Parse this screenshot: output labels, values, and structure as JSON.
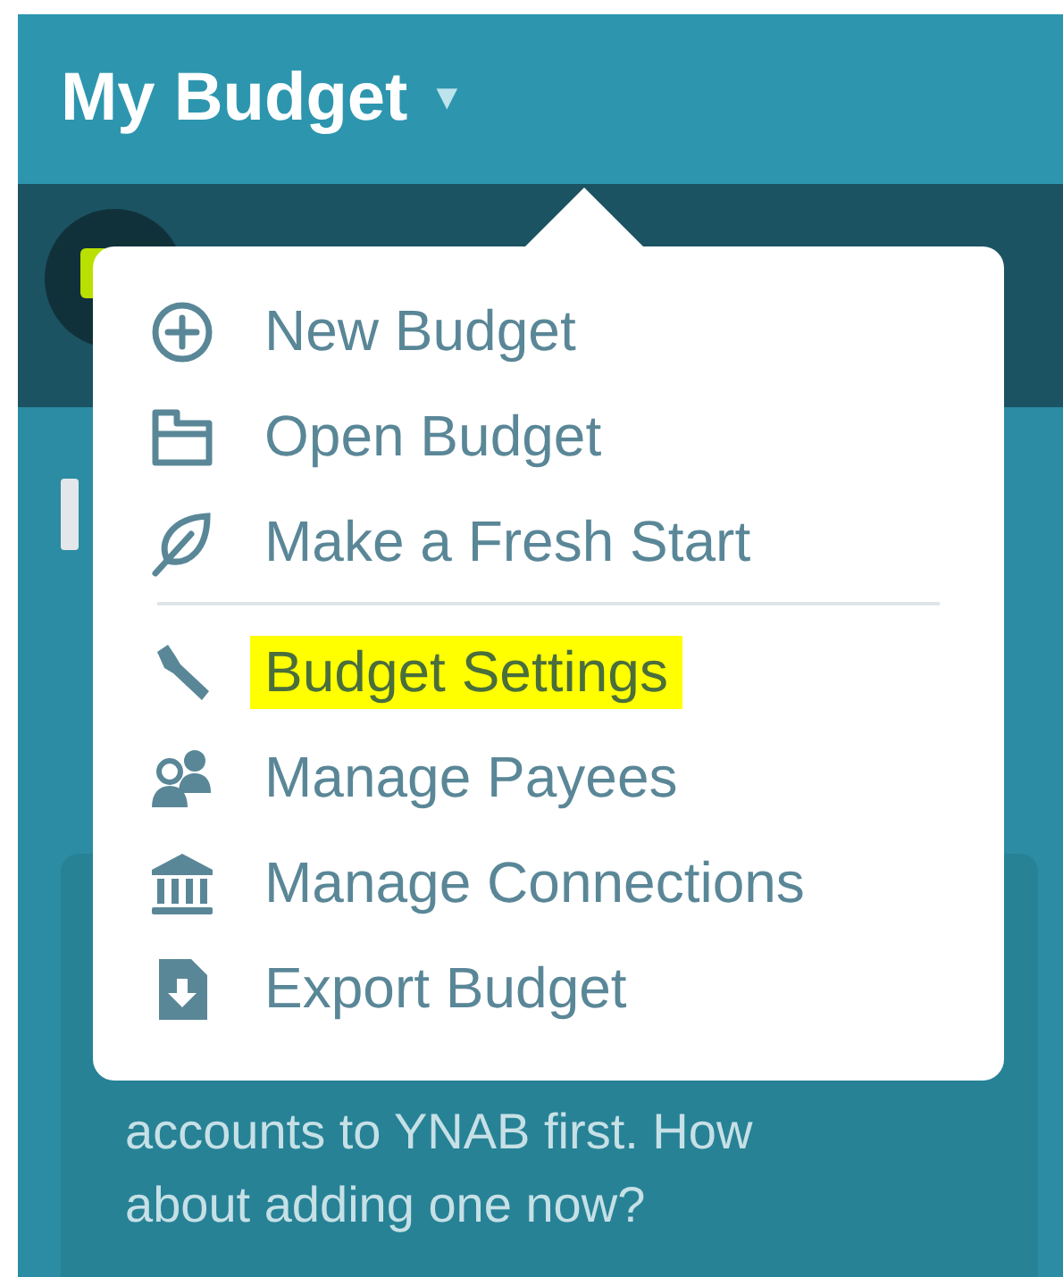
{
  "header": {
    "title": "My Budget",
    "caret": "▼"
  },
  "menu": {
    "sections": [
      {
        "items": [
          {
            "kind": "plus",
            "label": "New Budget",
            "highlighted": false
          },
          {
            "kind": "folder",
            "label": "Open Budget",
            "highlighted": false
          },
          {
            "kind": "leaf",
            "label": "Make a Fresh Start",
            "highlighted": false
          }
        ]
      },
      {
        "items": [
          {
            "kind": "wrench",
            "label": "Budget Settings",
            "highlighted": true
          },
          {
            "kind": "people",
            "label": "Manage Payees",
            "highlighted": false
          },
          {
            "kind": "bank",
            "label": "Manage Connections",
            "highlighted": false
          },
          {
            "kind": "export",
            "label": "Export Budget",
            "highlighted": false
          }
        ]
      }
    ]
  },
  "card": {
    "text": "accounts to YNAB first. How about adding one now?"
  }
}
